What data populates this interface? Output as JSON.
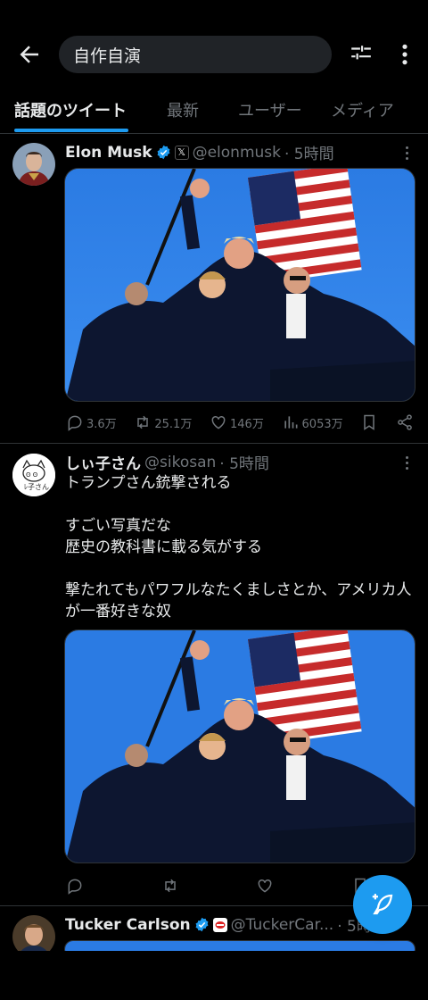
{
  "header": {
    "search_value": "自作自演"
  },
  "tabs": [
    {
      "label": "話題のツイート",
      "active": true
    },
    {
      "label": "最新",
      "active": false
    },
    {
      "label": "ユーザー",
      "active": false
    },
    {
      "label": "メディア",
      "active": false
    }
  ],
  "tweets": [
    {
      "name": "Elon Musk",
      "handle": "@elonmusk",
      "time": "· 5時間",
      "verified": true,
      "affiliation_icon": "x-logo-icon",
      "text": "",
      "stats": {
        "replies": "3.6万",
        "retweets": "25.1万",
        "likes": "146万",
        "views": "6053万"
      }
    },
    {
      "name": "しぃ子さん",
      "handle": "@sikosan",
      "time": "· 5時間",
      "verified": false,
      "text": "トランプさん銃撃される\n\nすごい写真だな\n歴史の教科書に載る気がする\n\n撃たれてもパワフルなたくましさとか、アメリカ人が一番好きな奴",
      "stats": {
        "replies": "",
        "retweets": "",
        "likes": "",
        "views": ""
      }
    },
    {
      "name": "Tucker Carlson",
      "handle": "@TuckerCar...",
      "time": "· 5時",
      "verified": true,
      "affiliation_icon": "tcn-logo-icon",
      "text": ""
    }
  ],
  "colors": {
    "accent": "#1d9bf0",
    "background": "#000000",
    "text_secondary": "#71767b"
  }
}
